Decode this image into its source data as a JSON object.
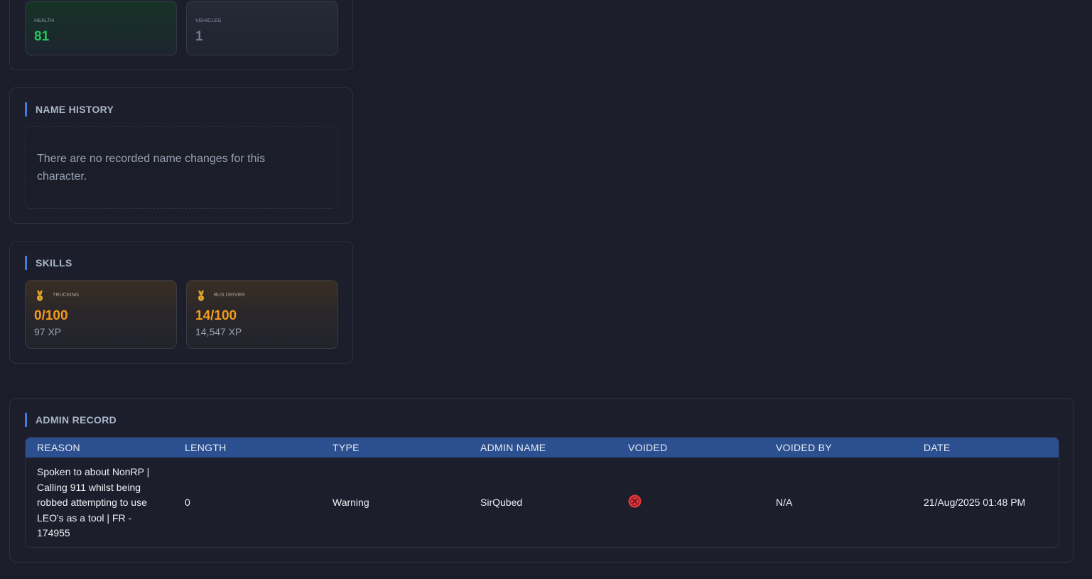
{
  "stats": {
    "health_label": "HEALTH",
    "health_value": "81",
    "vehicles_label": "VEHICLES",
    "vehicles_value": "1"
  },
  "name_history": {
    "title": "NAME HISTORY",
    "empty_message": "There are no recorded name changes for this character."
  },
  "skills": {
    "title": "SKILLS",
    "items": [
      {
        "name": "TRUCKING",
        "level": "0/100",
        "xp": "97 XP",
        "icon": "medal-icon"
      },
      {
        "name": "BUS DRIVER",
        "level": "14/100",
        "xp": "14,547 XP",
        "icon": "medal-icon"
      }
    ]
  },
  "admin_record": {
    "title": "ADMIN RECORD",
    "columns": [
      "REASON",
      "LENGTH",
      "TYPE",
      "ADMIN NAME",
      "VOIDED",
      "VOIDED BY",
      "DATE"
    ],
    "rows": [
      {
        "reason": "Spoken to about NonRP | Calling 911 whilst being robbed attempting to use LEO's as a tool | FR - 174955",
        "length": "0",
        "type": "Warning",
        "admin_name": "SirQubed",
        "voided": false,
        "voided_icon": "x-circle-icon",
        "voided_by": "N/A",
        "date": "21/Aug/2025 01:48 PM"
      }
    ]
  },
  "colors": {
    "background": "#1b1e29",
    "accent": "#3e7de0",
    "health_green": "#27c45e",
    "skill_orange": "#f49a1c",
    "table_header": "#2c4f8f",
    "voided_red": "#e5383b"
  }
}
